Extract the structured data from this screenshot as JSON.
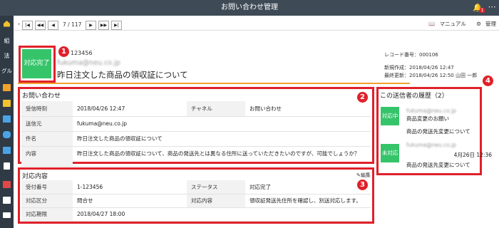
{
  "app": {
    "title": "お問い合わせ管理",
    "bell_badge": "1",
    "more_label": "⋯"
  },
  "sidebar": {
    "items": [
      {
        "label": "",
        "icon": "home-icon",
        "color": "#f2c12b"
      },
      {
        "label": "組",
        "icon": "text-item"
      },
      {
        "label": "法",
        "icon": "text-item"
      },
      {
        "label": "グル",
        "icon": "text-item"
      },
      {
        "label": "",
        "icon": "calendar-icon",
        "color": "#f2a12b"
      },
      {
        "label": "",
        "icon": "image-icon",
        "color": "#f2c12b"
      },
      {
        "label": "",
        "icon": "card-icon",
        "color": "#4aa3e6"
      },
      {
        "label": "",
        "icon": "chat-icon",
        "color": "#4aa3e6"
      },
      {
        "label": "",
        "icon": "list-icon",
        "color": "#4aa3e6"
      },
      {
        "label": "",
        "icon": "document-icon",
        "color": "#ffffff"
      },
      {
        "label": "",
        "icon": "mail-icon",
        "color": "#e04848"
      },
      {
        "label": "",
        "icon": "checklist-icon",
        "color": "#ffffff"
      },
      {
        "label": "",
        "icon": "presentation-icon",
        "color": "#ffffff"
      },
      {
        "label": "",
        "icon": "menu-icon",
        "color": "#f2c12b"
      }
    ]
  },
  "header": {
    "back_label": "戻る",
    "manual_label": "マニュアル",
    "admin_label": "管理"
  },
  "pager": {
    "buttons": [
      "|◀",
      "◀◀",
      "◀",
      "▶",
      "▶▶",
      "▶|"
    ],
    "current": "7",
    "total": "117"
  },
  "record": {
    "status": "対応完了",
    "code": "123456",
    "email": "fukuma@neu.co.jp",
    "subject": "昨日注文した商品の領収証について",
    "record_no_label": "レコード番号：",
    "record_no": "000106",
    "created_label": "新規作成：",
    "created": "2018/04/26 12:47",
    "updated_label": "最終更新：",
    "updated": "2018/04/26 12:50",
    "updated_by": "山田 一郎"
  },
  "inquiry": {
    "title": "お問い合わせ",
    "rows": [
      {
        "k1": "受信時刻",
        "v1": "2018/04/26 12:47",
        "k2": "チャネル",
        "v2": "お問い合わせ"
      },
      {
        "k1": "送信元",
        "v1": "fukuma@neu.co.jp"
      },
      {
        "k1": "件名",
        "v1": "昨日注文した商品の領収証について"
      },
      {
        "k1": "内容",
        "v1": "昨日注文した商品の領収証について、商品の発送先とは異なる住所に送っていただきたいのですが、可能でしょうか？"
      }
    ]
  },
  "response": {
    "title": "対応内容",
    "edit_label": "編集",
    "rows": [
      {
        "k1": "受付番号",
        "v1": "1-123456",
        "k2": "ステータス",
        "v2": "対応完了"
      },
      {
        "k1": "対応区分",
        "v1": "問合せ",
        "k2": "対応内容",
        "v2": "領収証発送先住所を確認し、別送対応します。"
      },
      {
        "k1": "対応期限",
        "v1": "2018/04/27 18:00"
      }
    ]
  },
  "history": {
    "title": "この送信者の履歴（2）",
    "items": [
      {
        "status": "対応中",
        "color": "#36c46a",
        "email": "fukuma@neu.co.jp",
        "lines": [
          "商品変更のお願い",
          "商品の発送先変更について"
        ]
      },
      {
        "status": "未対応",
        "color": "#36c46a",
        "email": "fukuma@neu.co.jp",
        "date": "4月26日 12:36",
        "lines": [
          "商品の発送先変更について"
        ]
      }
    ]
  },
  "callouts": [
    "1",
    "2",
    "3",
    "4"
  ],
  "colors": {
    "topbar": "#3e4a55",
    "sidebar": "#2f3a45",
    "highlight": "#e0202a",
    "status_green": "#36c46a",
    "divider_orange": "#f2a12b"
  }
}
